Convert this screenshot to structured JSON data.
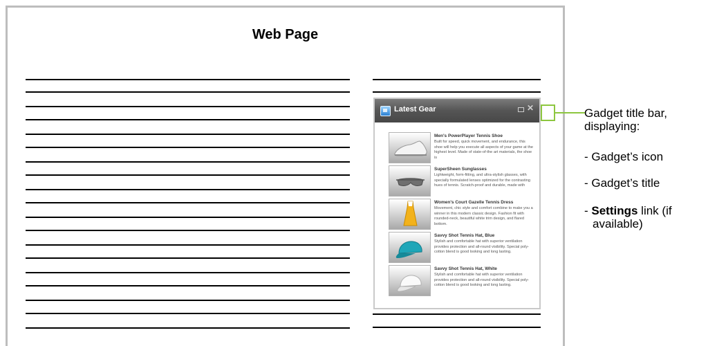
{
  "page": {
    "title": "Web Page"
  },
  "gadget": {
    "title": "Latest Gear",
    "icon": "gadget-icon",
    "controls": [
      "minimize-icon",
      "close-icon"
    ],
    "items": [
      {
        "title": "Men's PowerPlayer Tennis Shoe",
        "description": "Built for speed, quick movement, and endurance, this shoe will help you execute all aspects of your game at the highest level. Made of state-of-the art materials, the shoe is",
        "image": "tennis-shoe"
      },
      {
        "title": "SuperSheen Sunglasses",
        "description": "Lightweight, form-fitting, and ultra-stylish glasses, with specially formulated lenses optimized for the contrasting hues of tennis. Scratch-proof and durable, made with",
        "image": "sunglasses"
      },
      {
        "title": "Women's Court Gazelle Tennis Dress",
        "description": "Movement, chic style and comfort combine to make you a winner in this modern classic design. Fashion fit with rounded-neck, beautiful white trim design, and flared bottom.",
        "image": "tennis-dress"
      },
      {
        "title": "Savvy Shot Tennis Hat, Blue",
        "description": "Stylish and comfortable hat with superior ventilation provides protection and all-round visibility. Special poly-cotton blend is good looking and long lasting.",
        "image": "blue-hat"
      },
      {
        "title": "Savvy Shot Tennis Hat, White",
        "description": "Stylish and comfortable hat with superior ventilation provides protection and all-round visibility. Special poly-cotton blend is good looking and long lasting.",
        "image": "white-hat"
      }
    ]
  },
  "annotation": {
    "heading_line1": "Gadget title bar,",
    "heading_line2": "displaying:",
    "bullet1": "- Gadget’s icon",
    "bullet2": "- Gadget’s title",
    "bullet3_prefix": "- ",
    "bullet3_bold": "Settings",
    "bullet3_suffix": " link (if",
    "bullet3_line2": "available)"
  },
  "colors": {
    "callout": "#8dc63f",
    "frame": "#bdbdbd",
    "titlebar": "#555555"
  }
}
